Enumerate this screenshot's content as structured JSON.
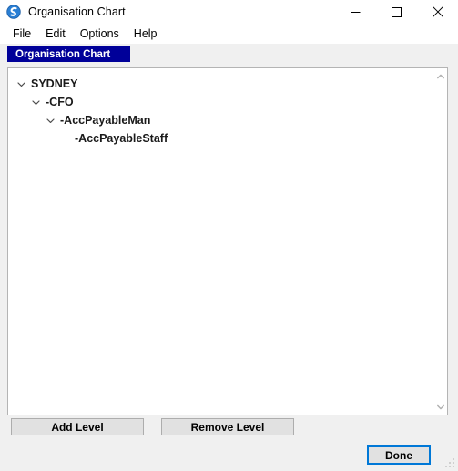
{
  "window": {
    "title": "Organisation Chart",
    "icon": "app-swirl-icon",
    "controls": {
      "minimize": "minimize-icon",
      "maximize": "maximize-icon",
      "close": "close-icon"
    }
  },
  "menubar": {
    "items": [
      {
        "label": "File"
      },
      {
        "label": "Edit"
      },
      {
        "label": "Options"
      },
      {
        "label": "Help"
      }
    ]
  },
  "tabs": [
    {
      "label": "Organisation Chart",
      "selected": true,
      "color": "#000099"
    }
  ],
  "tree": {
    "nodes": [
      {
        "label": "SYDNEY",
        "depth": 0,
        "expander": "chevron-down-icon",
        "expanded": true
      },
      {
        "label": "-CFO",
        "depth": 1,
        "expander": "chevron-down-icon",
        "expanded": true
      },
      {
        "label": "-AccPayableMan",
        "depth": 2,
        "expander": "chevron-down-icon",
        "expanded": true
      },
      {
        "label": "-AccPayableStaff",
        "depth": 3,
        "expander": "none",
        "expanded": false
      }
    ],
    "scrollbar": {
      "up_arrow": "scroll-up-arrow-icon",
      "down_arrow": "scroll-down-arrow-icon"
    }
  },
  "buttons": {
    "add_level": "Add Level",
    "remove_level": "Remove Level",
    "done": "Done"
  },
  "colors": {
    "tab_accent": "#000099",
    "focus_ring": "#0078d7",
    "window_background": "#f0f0f0",
    "panel_background": "#ffffff"
  }
}
